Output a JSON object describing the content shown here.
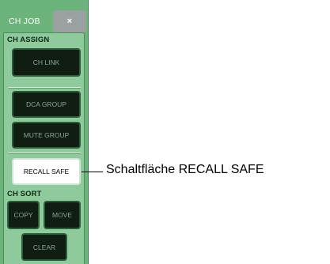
{
  "panel": {
    "title": "CH JOB",
    "close_label": "×"
  },
  "ch_assign": {
    "label": "CH ASSIGN",
    "buttons": [
      "CH LINK",
      "DCA GROUP",
      "MUTE GROUP"
    ],
    "recall_safe": "RECALL SAFE"
  },
  "ch_sort": {
    "label": "CH SORT",
    "copy": "COPY",
    "move": "MOVE",
    "clear": "CLEAR"
  },
  "callout": {
    "text": "Schaltfläche RECALL SAFE"
  }
}
